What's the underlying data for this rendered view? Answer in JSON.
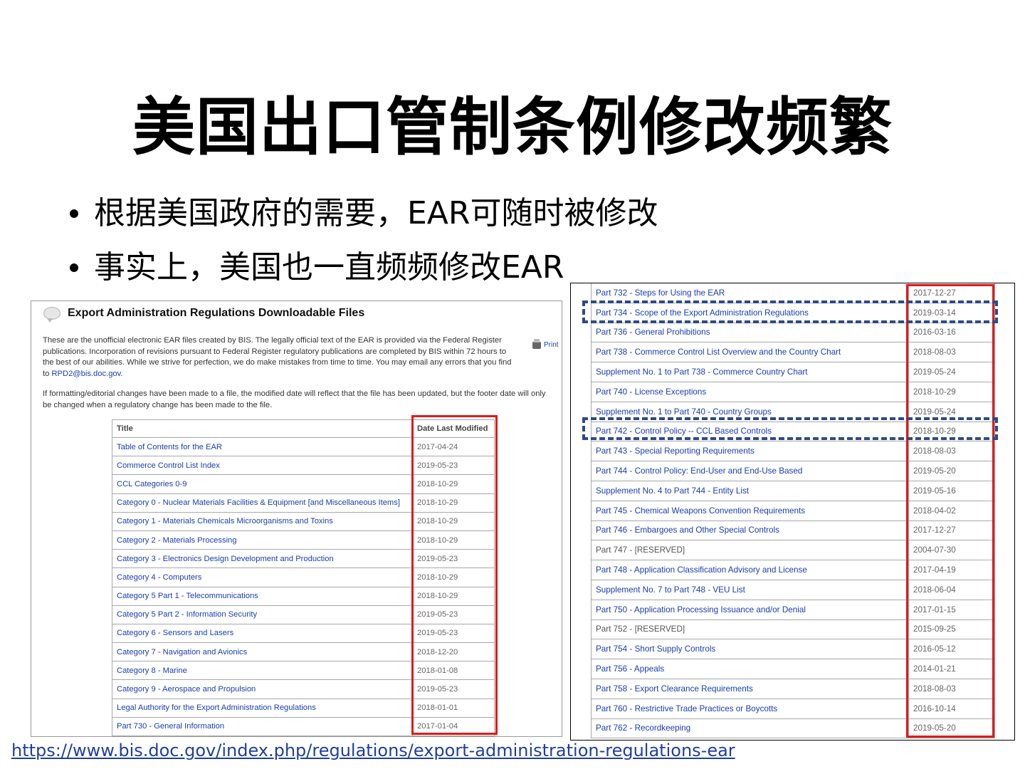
{
  "slide": {
    "title": "美国出口管制条例修改频繁",
    "bullets": [
      "根据美国政府的需要，EAR可随时被修改",
      "事实上，美国也一直频频修改EAR"
    ],
    "source_url": "https://www.bis.doc.gov/index.php/regulations/export-administration-regulations-ear"
  },
  "left_page": {
    "heading": "Export Administration Regulations Downloadable Files",
    "print_label": "Print",
    "intro_text": "These are the unofficial electronic EAR files created by BIS. The legally official text of the EAR is provided via the Federal Register publications. Incorporation of revisions pursuant to Federal Register regulatory publications are completed by BIS within 72 hours to the best of our abilities. While we strive for perfection, we do make mistakes from time to time. You may email any errors that you find to",
    "email": "RPD2@bis.doc.gov",
    "intro_end": ".",
    "note_text": "If formatting/editorial changes have been made to a file, the modified date will reflect that the file has been updated, but the footer date will only be changed when a regulatory change has been made to the file.",
    "col_title": "Title",
    "col_date": "Date Last Modified",
    "rows": [
      {
        "title": "Table of Contents for the EAR",
        "date": "2017-04-24"
      },
      {
        "title": "Commerce Control List Index",
        "date": "2019-05-23"
      },
      {
        "title": "CCL Categories 0-9",
        "date": "2018-10-29"
      },
      {
        "title": "Category 0 - Nuclear Materials Facilities & Equipment [and Miscellaneous Items]",
        "date": "2018-10-29"
      },
      {
        "title": "Category 1 - Materials Chemicals Microorganisms and Toxins",
        "date": "2018-10-29"
      },
      {
        "title": "Category 2 - Materials Processing",
        "date": "2018-10-29"
      },
      {
        "title": "Category 3 - Electronics Design Development and Production",
        "date": "2019-05-23"
      },
      {
        "title": "Category 4 - Computers",
        "date": "2018-10-29"
      },
      {
        "title": "Category 5 Part 1 - Telecommunications",
        "date": "2018-10-29"
      },
      {
        "title": "Category 5 Part 2 - Information Security",
        "date": "2019-05-23"
      },
      {
        "title": "Category 6 - Sensors and Lasers",
        "date": "2019-05-23"
      },
      {
        "title": "Category 7 - Navigation and Avionics",
        "date": "2018-12-20"
      },
      {
        "title": "Category 8 - Marine",
        "date": "2018-01-08"
      },
      {
        "title": "Category 9 - Aerospace and Propulsion",
        "date": "2019-05-23"
      },
      {
        "title": "Legal Authority for the Export Administration Regulations",
        "date": "2018-01-01"
      },
      {
        "title": "Part 730 - General Information",
        "date": "2017-01-04"
      }
    ]
  },
  "right_page": {
    "rows": [
      {
        "title": "Part 732 - Steps for Using the EAR",
        "date": "2017-12-27"
      },
      {
        "title": "Part 734 - Scope of the Export Administration Regulations",
        "date": "2019-03-14"
      },
      {
        "title": "Part 736 - General Prohibitions",
        "date": "2016-03-16"
      },
      {
        "title": "Part 738 - Commerce Control List Overview and the Country Chart",
        "date": "2018-08-03"
      },
      {
        "title": "Supplement No. 1 to Part 738 - Commerce Country Chart",
        "date": "2019-05-24"
      },
      {
        "title": "Part 740 - License Exceptions",
        "date": "2018-10-29"
      },
      {
        "title": "Supplement No. 1 to Part 740 - Country Groups",
        "date": "2019-05-24"
      },
      {
        "title": "Part 742 - Control Policy -- CCL Based Controls",
        "date": "2018-10-29"
      },
      {
        "title": "Part 743 - Special Reporting Requirements",
        "date": "2018-08-03"
      },
      {
        "title": "Part 744 - Control Policy: End-User and End-Use Based",
        "date": "2019-05-20"
      },
      {
        "title": "Supplement No. 4 to Part 744 - Entity List",
        "date": "2019-05-16"
      },
      {
        "title": "Part 745 - Chemical Weapons Convention Requirements",
        "date": "2018-04-02"
      },
      {
        "title": "Part 746 - Embargoes and Other Special Controls",
        "date": "2017-12-27"
      },
      {
        "title": "Part 747 - [RESERVED]",
        "date": "2004-07-30"
      },
      {
        "title": "Part 748 - Application Classification Advisory and License",
        "date": "2017-04-19"
      },
      {
        "title": "Supplement No. 7 to Part 748 - VEU List",
        "date": "2018-06-04"
      },
      {
        "title": "Part 750 - Application Processing Issuance and/or Denial",
        "date": "2017-01-15"
      },
      {
        "title": "Part 752 - [RESERVED]",
        "date": "2015-09-25"
      },
      {
        "title": "Part 754 - Short Supply Controls",
        "date": "2016-05-12"
      },
      {
        "title": "Part 756 - Appeals",
        "date": "2014-01-21"
      },
      {
        "title": "Part 758 - Export Clearance Requirements",
        "date": "2018-08-03"
      },
      {
        "title": "Part 760 - Restrictive Trade Practices or Boycotts",
        "date": "2016-10-14"
      },
      {
        "title": "Part 762 - Recordkeeping",
        "date": "2019-05-20"
      }
    ]
  },
  "colors": {
    "highlight_red": "#e01a1a",
    "highlight_dashed_blue": "#2e4a86",
    "link_blue": "#1a3db0"
  }
}
